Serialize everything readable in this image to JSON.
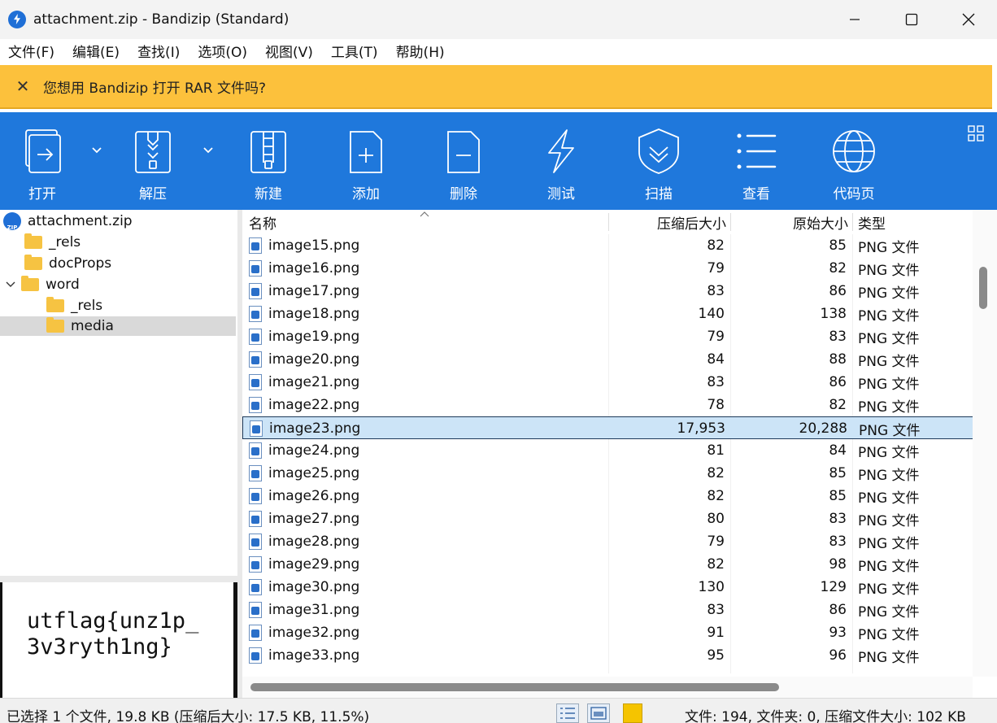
{
  "window": {
    "title": "attachment.zip - Bandizip (Standard)",
    "minimize_icon": "minimize-icon",
    "maximize_icon": "maximize-icon",
    "close_icon": "close-icon"
  },
  "menu": [
    "文件(F)",
    "编辑(E)",
    "查找(I)",
    "选项(O)",
    "视图(V)",
    "工具(T)",
    "帮助(H)"
  ],
  "notification": {
    "close_symbol": "✕",
    "text": "您想用 Bandizip 打开 RAR 文件吗?",
    "background": "#fcc13c"
  },
  "toolbar": {
    "background": "#1f78dc",
    "buttons": [
      {
        "label": "打开",
        "icon": "open-icon"
      },
      {
        "label": "解压",
        "icon": "extract-icon"
      },
      {
        "label": "新建",
        "icon": "new-archive-icon"
      },
      {
        "label": "添加",
        "icon": "add-file-icon"
      },
      {
        "label": "删除",
        "icon": "delete-file-icon"
      },
      {
        "label": "测试",
        "icon": "test-icon"
      },
      {
        "label": "扫描",
        "icon": "scan-icon"
      },
      {
        "label": "查看",
        "icon": "view-list-icon"
      },
      {
        "label": "代码页",
        "icon": "codepage-globe-icon"
      }
    ]
  },
  "tree": {
    "root": "attachment.zip",
    "items": [
      "_rels",
      "docProps",
      "word",
      "_rels",
      "media"
    ],
    "selected": "media"
  },
  "preview": {
    "text": "utflag{unz1p_\n3v3ryth1ng}"
  },
  "list": {
    "columns": [
      "名称",
      "压缩后大小",
      "原始大小",
      "类型"
    ],
    "rows": [
      {
        "name": "image15.png",
        "compressed": "82",
        "original": "85",
        "type": "PNG 文件"
      },
      {
        "name": "image16.png",
        "compressed": "79",
        "original": "82",
        "type": "PNG 文件"
      },
      {
        "name": "image17.png",
        "compressed": "83",
        "original": "86",
        "type": "PNG 文件"
      },
      {
        "name": "image18.png",
        "compressed": "140",
        "original": "138",
        "type": "PNG 文件"
      },
      {
        "name": "image19.png",
        "compressed": "79",
        "original": "83",
        "type": "PNG 文件"
      },
      {
        "name": "image20.png",
        "compressed": "84",
        "original": "88",
        "type": "PNG 文件"
      },
      {
        "name": "image21.png",
        "compressed": "83",
        "original": "86",
        "type": "PNG 文件"
      },
      {
        "name": "image22.png",
        "compressed": "78",
        "original": "82",
        "type": "PNG 文件"
      },
      {
        "name": "image23.png",
        "compressed": "17,953",
        "original": "20,288",
        "type": "PNG 文件"
      },
      {
        "name": "image24.png",
        "compressed": "81",
        "original": "84",
        "type": "PNG 文件"
      },
      {
        "name": "image25.png",
        "compressed": "82",
        "original": "85",
        "type": "PNG 文件"
      },
      {
        "name": "image26.png",
        "compressed": "82",
        "original": "85",
        "type": "PNG 文件"
      },
      {
        "name": "image27.png",
        "compressed": "80",
        "original": "83",
        "type": "PNG 文件"
      },
      {
        "name": "image28.png",
        "compressed": "79",
        "original": "83",
        "type": "PNG 文件"
      },
      {
        "name": "image29.png",
        "compressed": "82",
        "original": "98",
        "type": "PNG 文件"
      },
      {
        "name": "image30.png",
        "compressed": "130",
        "original": "129",
        "type": "PNG 文件"
      },
      {
        "name": "image31.png",
        "compressed": "83",
        "original": "86",
        "type": "PNG 文件"
      },
      {
        "name": "image32.png",
        "compressed": "91",
        "original": "93",
        "type": "PNG 文件"
      },
      {
        "name": "image33.png",
        "compressed": "95",
        "original": "96",
        "type": "PNG 文件"
      }
    ],
    "selected_row": "image23.png",
    "selection_color": "#cce4f7"
  },
  "status": {
    "left": "已选择 1 个文件, 19.8 KB (压缩后大小: 17.5 KB, 11.5%)",
    "right": "文件: 194, 文件夹: 0, 压缩文件大小: 102 KB"
  }
}
